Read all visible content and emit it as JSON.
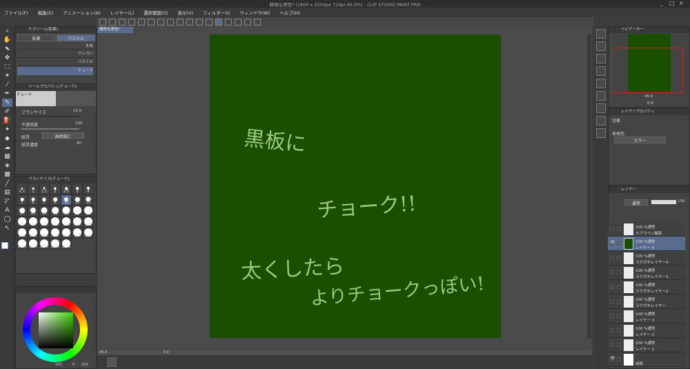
{
  "window": {
    "title": "精悍な男性* (1800 x 2500px 72dpi 45.0%) - CLIP STUDIO PAINT PRO",
    "minimize": "_",
    "maximize": "□",
    "close": "×"
  },
  "menu": [
    "ファイル(F)",
    "編集(E)",
    "アニメーション(A)",
    "レイヤー(L)",
    "選択範囲(S)",
    "表示(V)",
    "フィルター(I)",
    "ウィンドウ(W)",
    "ヘルプ(H)"
  ],
  "document_tab": "精悍な男性*",
  "subtool": {
    "title": "サブツール[鉛筆]",
    "tabs": [
      "鉛筆",
      "パステル"
    ],
    "active_tab": "パステル",
    "brushes": [
      "木炭",
      "クレヨン",
      "パステル",
      "チョーク"
    ],
    "selected": "チョーク"
  },
  "tool_property": {
    "title": "ツールプロパティ[チョーク]",
    "preview_label": "チョーク",
    "brush_size_label": "ブラシサイズ",
    "brush_size": "10.0",
    "opacity_label": "不透明度",
    "opacity": "100",
    "paper_label": "紙質",
    "paper_value": "画用紙C",
    "paper_density_label": "紙質濃度",
    "paper_density": "80"
  },
  "brush_size_panel": {
    "title": "ブラシサイズ[チョーク]",
    "sizes": [
      "0.7",
      "1",
      "1.5",
      "2",
      "2.5",
      "3",
      "4",
      "5",
      "6",
      "7",
      "8",
      "10",
      "12",
      "15",
      "17",
      "20",
      "25",
      "30",
      "40",
      "50",
      "60",
      "70",
      "80",
      "100",
      "120",
      "150",
      "170",
      "200",
      "250",
      "300",
      "400",
      "500",
      "600",
      "700",
      "800",
      "1000",
      "1200",
      "1500",
      "1700",
      "2000"
    ],
    "selected": "10"
  },
  "color": {
    "hue_color": "#3cd400",
    "readout_a": "105",
    "readout_b": "0",
    "readout_c": "100"
  },
  "canvas": {
    "background": "#1a4f00",
    "chalk_color": "#a8d68a",
    "lines": [
      "黒板に",
      "チョーク!!",
      "太くしたら",
      "よりチョークっぽい!"
    ]
  },
  "status": {
    "zoom": "45.0",
    "angle": "0.0"
  },
  "navigator": {
    "title": "ナビゲーター",
    "zoom": "45.0",
    "angle": "0.0"
  },
  "layer_property": {
    "title": "レイヤープロパティ",
    "effect_label": "効果",
    "expression_label": "表現色",
    "expression_value": "カラー"
  },
  "layers": {
    "title": "レイヤー",
    "blend_mode": "通常",
    "opacity": "100",
    "items": [
      {
        "mode": "100 %通常",
        "name": "カブラペン輪郭",
        "selected": false,
        "visible": false
      },
      {
        "mode": "100 %通常",
        "name": "レイヤー 4",
        "selected": true,
        "visible": true
      },
      {
        "mode": "100 %通常",
        "name": "ラクガキレイヤー4",
        "selected": false,
        "visible": false
      },
      {
        "mode": "100 %通常",
        "name": "ラクガキレイヤー3",
        "selected": false,
        "visible": false
      },
      {
        "mode": "100 %通常",
        "name": "ラクガキレイヤー2",
        "selected": false,
        "visible": false
      },
      {
        "mode": "100 %通常",
        "name": "ラクガキレイヤー",
        "selected": false,
        "visible": false
      },
      {
        "mode": "100 %通常",
        "name": "レイヤー 3",
        "selected": false,
        "visible": false
      },
      {
        "mode": "100 %通常",
        "name": "レイヤー 2",
        "selected": false,
        "visible": false
      },
      {
        "mode": "100 %通常",
        "name": "レイヤー 1",
        "selected": false,
        "visible": false
      },
      {
        "mode": "",
        "name": "用紙",
        "selected": false,
        "visible": true
      }
    ]
  }
}
